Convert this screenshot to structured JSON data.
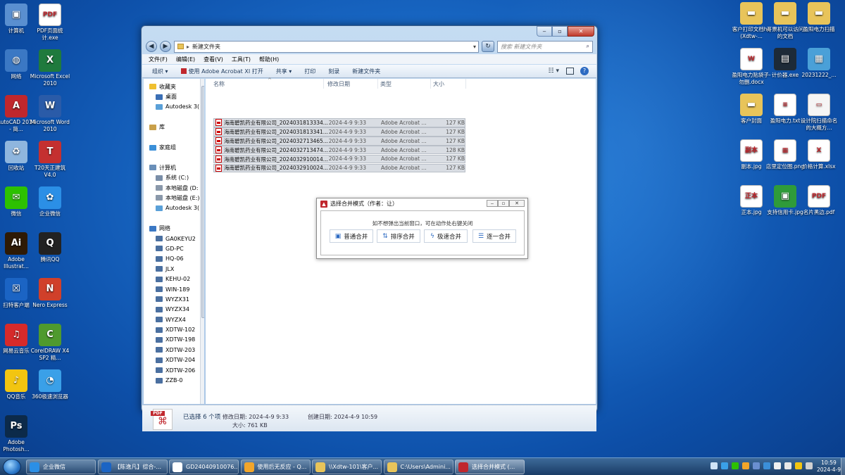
{
  "desktop_left": [
    {
      "label": "计算机",
      "icon": "computer-icon",
      "color": "#5a8fd0",
      "glyph": "▣"
    },
    {
      "label": "PDF页面统计.exe",
      "icon": "pdf-exe-icon",
      "color": "#ffffff",
      "glyph": "PDF"
    },
    {
      "label": "网络",
      "icon": "network-icon",
      "color": "#3b78c4",
      "glyph": "◍"
    },
    {
      "label": "Microsoft Excel 2010",
      "icon": "excel-icon",
      "color": "#1f7a3d",
      "glyph": "X"
    },
    {
      "label": "AutoCAD 2014 - 简...",
      "icon": "autocad-icon",
      "color": "#c0272d",
      "glyph": "A"
    },
    {
      "label": "Microsoft Word 2010",
      "icon": "word-icon",
      "color": "#2a5ba8",
      "glyph": "W"
    },
    {
      "label": "回收站",
      "icon": "recycle-bin-icon",
      "color": "#8fb6de",
      "glyph": "♻"
    },
    {
      "label": "T20天正建筑V4.0",
      "icon": "t20-icon",
      "color": "#c43030",
      "glyph": "T"
    },
    {
      "label": "微信",
      "icon": "wechat-icon",
      "color": "#2dc100",
      "glyph": "✉"
    },
    {
      "label": "企业微信",
      "icon": "wecom-icon",
      "color": "#2b8fe6",
      "glyph": "✿"
    },
    {
      "label": "Adobe Illustrat...",
      "icon": "illustrator-icon",
      "color": "#2e1a05",
      "glyph": "Ai"
    },
    {
      "label": "腾讯QQ",
      "icon": "qq-icon",
      "color": "#222222",
      "glyph": "Q"
    },
    {
      "label": "扫特客户端",
      "icon": "client-icon",
      "color": "#1b64c4",
      "glyph": "☒"
    },
    {
      "label": "Nero Express",
      "icon": "nero-icon",
      "color": "#d0402a",
      "glyph": "N"
    },
    {
      "label": "网易云音乐",
      "icon": "netease-music-icon",
      "color": "#d62a2a",
      "glyph": "♫"
    },
    {
      "label": "CorelDRAW X4 SP2 精...",
      "icon": "coreldraw-icon",
      "color": "#4f9a2e",
      "glyph": "C"
    },
    {
      "label": "QQ音乐",
      "icon": "qq-music-icon",
      "color": "#f2c511",
      "glyph": "♪"
    },
    {
      "label": "360极速浏览器",
      "icon": "360-browser-icon",
      "color": "#3aa0e8",
      "glyph": "◔"
    },
    {
      "label": "Adobe Photosh...",
      "icon": "photoshop-icon",
      "color": "#0c2a4a",
      "glyph": "Ps"
    }
  ],
  "desktop_right": [
    {
      "label": "客户打印文档hq (Xdtw-...",
      "icon": "folder-icon",
      "color": "#e8c45a",
      "glyph": "▬"
    },
    {
      "label": "开票机可以访问的文档",
      "icon": "folder-icon",
      "color": "#e8c45a",
      "glyph": "▬"
    },
    {
      "label": "盈阳电力扫描",
      "icon": "folder-icon",
      "color": "#e8c45a",
      "glyph": "▬"
    },
    {
      "label": "盈阳电力贴袋子-勿删.docx",
      "icon": "word-doc-icon",
      "color": "#ffffff",
      "glyph": "W"
    },
    {
      "label": "计价器.exe",
      "icon": "exe-icon",
      "color": "#1d2a38",
      "glyph": "▤"
    },
    {
      "label": "20231222_...",
      "icon": "image-icon",
      "color": "#4aa0d8",
      "glyph": "▦"
    },
    {
      "label": "客户封面",
      "icon": "folder-doc-icon",
      "color": "#e8c45a",
      "glyph": "▬"
    },
    {
      "label": "盈阳电力.txt",
      "icon": "txt-icon",
      "color": "#ffffff",
      "glyph": "≡"
    },
    {
      "label": "设计院扫描命名的大概方...",
      "icon": "image-icon",
      "color": "#f5f5f5",
      "glyph": "▭"
    },
    {
      "label": "副本.jpg",
      "icon": "jpg-icon",
      "color": "#ffffff",
      "glyph": "副本"
    },
    {
      "label": "店里定位图.png",
      "icon": "png-icon",
      "color": "#ffffff",
      "glyph": "▦"
    },
    {
      "label": "价格计算.xlsx",
      "icon": "xlsx-icon",
      "color": "#ffffff",
      "glyph": "X"
    },
    {
      "label": "正本.jpg",
      "icon": "jpg-icon",
      "color": "#ffffff",
      "glyph": "正本"
    },
    {
      "label": "支持信用卡.jpg",
      "icon": "jpg-icon",
      "color": "#2f9b3a",
      "glyph": "▣"
    },
    {
      "label": "名片黑边.pdf",
      "icon": "pdf-icon",
      "color": "#ffffff",
      "glyph": "PDF"
    }
  ],
  "explorer": {
    "address": "新建文件夹",
    "search_placeholder": "搜索 新建文件夹",
    "menu": [
      "文件(F)",
      "编辑(E)",
      "查看(V)",
      "工具(T)",
      "帮助(H)"
    ],
    "toolbar": [
      "组织 ▾",
      "使用 Adobe Acrobat XI 打开",
      "共享 ▾",
      "打印",
      "刻录",
      "新建文件夹"
    ],
    "nav": [
      {
        "label": "收藏夹",
        "indent": 0,
        "color": "#f0c030"
      },
      {
        "label": "桌面",
        "indent": 1,
        "color": "#3b6fb5"
      },
      {
        "label": "Autodesk 3(",
        "indent": 1,
        "color": "#5aa0d8"
      },
      {
        "label": "",
        "indent": 0,
        "color": ""
      },
      {
        "label": "库",
        "indent": 0,
        "color": "#c9a04a"
      },
      {
        "label": "",
        "indent": 0,
        "color": ""
      },
      {
        "label": "家庭组",
        "indent": 0,
        "color": "#3b8fd8"
      },
      {
        "label": "",
        "indent": 0,
        "color": ""
      },
      {
        "label": "计算机",
        "indent": 0,
        "color": "#6a8fb8"
      },
      {
        "label": "系统 (C:)",
        "indent": 1,
        "color": "#7a8ea8"
      },
      {
        "label": "本地磁盘 (D:",
        "indent": 1,
        "color": "#8a98aa"
      },
      {
        "label": "本地磁盘 (E:)",
        "indent": 1,
        "color": "#8a98aa"
      },
      {
        "label": "Autodesk 3(",
        "indent": 1,
        "color": "#5aa0d8"
      },
      {
        "label": "",
        "indent": 0,
        "color": ""
      },
      {
        "label": "网络",
        "indent": 0,
        "color": "#3b78c4"
      },
      {
        "label": "GA0KEYU2",
        "indent": 1,
        "color": "#4a6fa0"
      },
      {
        "label": "GD-PC",
        "indent": 1,
        "color": "#4a6fa0"
      },
      {
        "label": "HQ-06",
        "indent": 1,
        "color": "#4a6fa0"
      },
      {
        "label": "JLX",
        "indent": 1,
        "color": "#4a6fa0"
      },
      {
        "label": "KEHU-02",
        "indent": 1,
        "color": "#4a6fa0"
      },
      {
        "label": "WIN-189",
        "indent": 1,
        "color": "#4a6fa0"
      },
      {
        "label": "WYZX31",
        "indent": 1,
        "color": "#4a6fa0"
      },
      {
        "label": "WYZX34",
        "indent": 1,
        "color": "#4a6fa0"
      },
      {
        "label": "WYZX4",
        "indent": 1,
        "color": "#4a6fa0"
      },
      {
        "label": "XDTW-102",
        "indent": 1,
        "color": "#4a6fa0"
      },
      {
        "label": "XDTW-198",
        "indent": 1,
        "color": "#4a6fa0"
      },
      {
        "label": "XDTW-203",
        "indent": 1,
        "color": "#4a6fa0"
      },
      {
        "label": "XDTW-204",
        "indent": 1,
        "color": "#4a6fa0"
      },
      {
        "label": "XDTW-206",
        "indent": 1,
        "color": "#4a6fa0"
      },
      {
        "label": "ZZB-0",
        "indent": 1,
        "color": "#4a6fa0"
      }
    ],
    "columns": [
      "名称",
      "修改日期",
      "类型",
      "大小"
    ],
    "files": [
      {
        "name": "海南碧凯药业有限公司_202403181333­4...",
        "date": "2024-4-9 9:33",
        "type": "Adobe Acrobat ...",
        "size": "127 KB"
      },
      {
        "name": "海南碧凯药业有限公司_2024031813341...",
        "date": "2024-4-9 9:33",
        "type": "Adobe Acrobat ...",
        "size": "127 KB"
      },
      {
        "name": "海南碧凯药业有限公司_2024032713465...",
        "date": "2024-4-9 9:33",
        "type": "Adobe Acrobat ...",
        "size": "127 KB"
      },
      {
        "name": "海南碧凯药业有限公司_2024032713474...",
        "date": "2024-4-9 9:33",
        "type": "Adobe Acrobat ...",
        "size": "128 KB"
      },
      {
        "name": "海南碧凯药业有限公司_2024032910014...",
        "date": "2024-4-9 9:33",
        "type": "Adobe Acrobat ...",
        "size": "127 KB"
      },
      {
        "name": "海南碧凯药业有限公司_2024032910024...",
        "date": "2024-4-9 9:33",
        "type": "Adobe Acrobat ...",
        "size": "127 KB"
      }
    ],
    "status": {
      "selected": "已选择 6 个项",
      "modified": "修改日期: 2024-4-9 9:33",
      "created": "创建日期: 2024-4-9 10:59",
      "size": "大小: 761 KB",
      "icon_label": "PDF"
    }
  },
  "dialog": {
    "title": "选择合并模式（作者：让）",
    "hint": "如不想弹出当前窗口，可在动作处右键关闭",
    "buttons": [
      {
        "label": "普通合并",
        "icon": "person-card-icon",
        "glyph": "▣"
      },
      {
        "label": "排序合并",
        "icon": "sort-icon",
        "glyph": "⇅"
      },
      {
        "label": "极速合并",
        "icon": "lightning-icon",
        "glyph": "ϟ"
      },
      {
        "label": "逐一合并",
        "icon": "list-icon",
        "glyph": "☰"
      }
    ]
  },
  "taskbar": {
    "items": [
      {
        "label": "企业微信",
        "color": "#2b8fe6"
      },
      {
        "label": "【陈逸凡】综合-...",
        "color": "#1b64c4"
      },
      {
        "label": "GD24040910076...",
        "color": "#ffffff"
      },
      {
        "label": "使用后无反应 - Q...",
        "color": "#f2a52a"
      },
      {
        "label": "\\\\Xdtw-101\\客户...",
        "color": "#e8c45a"
      },
      {
        "label": "C:\\Users\\Admini...",
        "color": "#e8c45a"
      },
      {
        "label": "选择合并模式 (...",
        "color": "#c0272d"
      }
    ],
    "time": "10:59",
    "date": "2024-4-9",
    "tray_colors": [
      "#cfe3f6",
      "#3aa0e8",
      "#2dc100",
      "#f2a52a",
      "#6a8fd0",
      "#3b8fd8",
      "#f0f0f0",
      "#e8e8e8",
      "#f2c511",
      "#d0d0d0"
    ]
  }
}
